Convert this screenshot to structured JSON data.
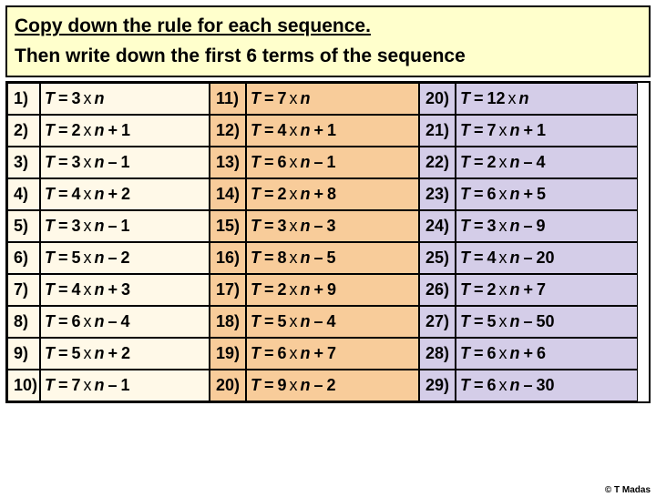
{
  "header": {
    "line1": "Copy down the rule for each sequence.",
    "line2": "Then write  down the first 6 terms of the sequence"
  },
  "symbols": {
    "T": "T",
    "eq": "=",
    "x": "x",
    "n": "n"
  },
  "columns": [
    {
      "bg": "col1",
      "rows": [
        {
          "num": "1)",
          "coef": "3",
          "op": "",
          "c": ""
        },
        {
          "num": "2)",
          "coef": "2",
          "op": "+",
          "c": "1"
        },
        {
          "num": "3)",
          "coef": "3",
          "op": "–",
          "c": "1"
        },
        {
          "num": "4)",
          "coef": "4",
          "op": "+",
          "c": "2"
        },
        {
          "num": "5)",
          "coef": "3",
          "op": "–",
          "c": "1"
        },
        {
          "num": "6)",
          "coef": "5",
          "op": "–",
          "c": "2"
        },
        {
          "num": "7)",
          "coef": "4",
          "op": "+",
          "c": "3"
        },
        {
          "num": "8)",
          "coef": "6",
          "op": "–",
          "c": "4"
        },
        {
          "num": "9)",
          "coef": "5",
          "op": "+",
          "c": "2"
        },
        {
          "num": "10)",
          "coef": "7",
          "op": "–",
          "c": "1"
        }
      ]
    },
    {
      "bg": "col2",
      "rows": [
        {
          "num": "11)",
          "coef": "7",
          "op": "",
          "c": ""
        },
        {
          "num": "12)",
          "coef": "4",
          "op": "+",
          "c": "1"
        },
        {
          "num": "13)",
          "coef": "6",
          "op": "–",
          "c": "1"
        },
        {
          "num": "14)",
          "coef": "2",
          "op": "+",
          "c": "8"
        },
        {
          "num": "15)",
          "coef": "3",
          "op": "–",
          "c": "3"
        },
        {
          "num": "16)",
          "coef": "8",
          "op": "–",
          "c": "5"
        },
        {
          "num": "17)",
          "coef": "2",
          "op": "+",
          "c": "9"
        },
        {
          "num": "18)",
          "coef": "5",
          "op": "–",
          "c": "4"
        },
        {
          "num": "19)",
          "coef": "6",
          "op": "+",
          "c": "7"
        },
        {
          "num": "20)",
          "coef": "9",
          "op": "–",
          "c": "2"
        }
      ]
    },
    {
      "bg": "col3",
      "rows": [
        {
          "num": "20)",
          "coef": "12",
          "op": "",
          "c": ""
        },
        {
          "num": "21)",
          "coef": "7",
          "op": "+",
          "c": "1"
        },
        {
          "num": "22)",
          "coef": "2",
          "op": "–",
          "c": "4"
        },
        {
          "num": "23)",
          "coef": "6",
          "op": "+",
          "c": "5"
        },
        {
          "num": "24)",
          "coef": "3",
          "op": "–",
          "c": "9"
        },
        {
          "num": "25)",
          "coef": "4",
          "op": "–",
          "c": "20"
        },
        {
          "num": "26)",
          "coef": "2",
          "op": "+",
          "c": "7"
        },
        {
          "num": "27)",
          "coef": "5",
          "op": "–",
          "c": "50"
        },
        {
          "num": "28)",
          "coef": "6",
          "op": "+",
          "c": "6"
        },
        {
          "num": "29)",
          "coef": "6",
          "op": "–",
          "c": "30"
        }
      ]
    }
  ],
  "credit": "© T Madas"
}
